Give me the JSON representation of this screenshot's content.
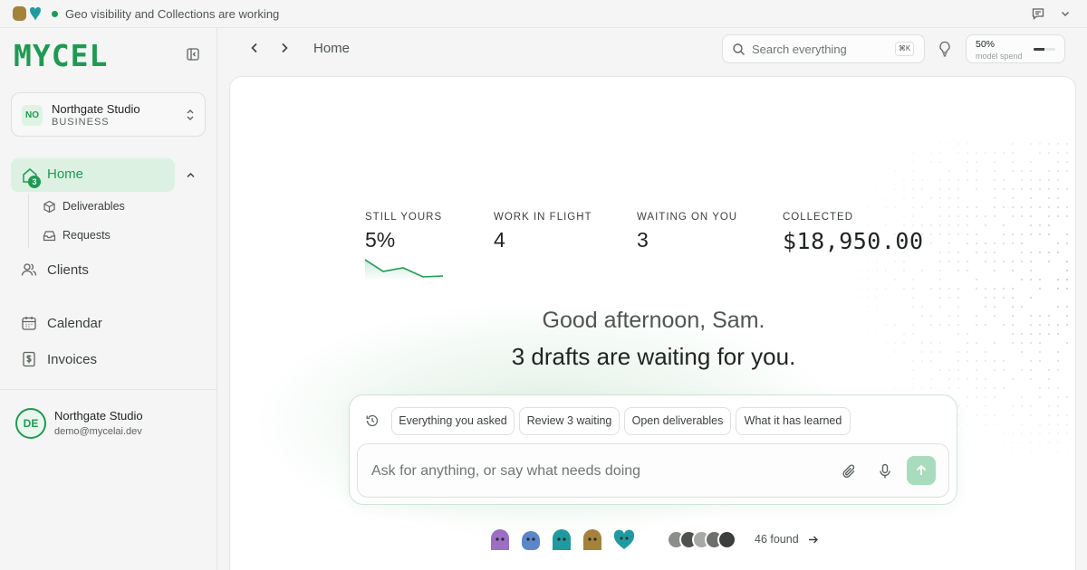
{
  "topbar": {
    "status_text": "Geo visibility and Collections are working",
    "status_color": "#1e9a52",
    "icons": [
      "mycel-mini-logo",
      "chat-icon",
      "chevron-down-icon"
    ]
  },
  "sidebar": {
    "brand": "MYCEL",
    "workspace": {
      "initials": "NO",
      "name": "Northgate Studio",
      "plan": "BUSINESS"
    },
    "home": {
      "label": "Home",
      "badge": "3"
    },
    "subitems": [
      {
        "label": "Deliverables",
        "icon": "box-icon"
      },
      {
        "label": "Requests",
        "icon": "inbox-icon"
      }
    ],
    "items": [
      {
        "label": "Clients",
        "icon": "users-icon"
      },
      {
        "label": "Calendar",
        "icon": "calendar-icon"
      },
      {
        "label": "Invoices",
        "icon": "invoice-icon"
      }
    ],
    "user": {
      "initials": "DE",
      "name": "Northgate Studio",
      "email": "demo@mycelai.dev"
    }
  },
  "header": {
    "breadcrumb": "Home",
    "search_placeholder": "Search everything",
    "search_shortcut": "⌘K",
    "spend": {
      "value": "50%",
      "label": "model spend",
      "fraction": 0.5
    }
  },
  "main": {
    "stats": [
      {
        "label": "STILL YOURS",
        "value": "5%"
      },
      {
        "label": "WORK IN FLIGHT",
        "value": "4"
      },
      {
        "label": "WAITING ON YOU",
        "value": "3"
      },
      {
        "label": "COLLECTED",
        "value": "$18,950.00"
      }
    ],
    "greeting": "Good afternoon, Sam.",
    "headline": "3 drafts are waiting for you.",
    "chips": [
      "Everything you asked",
      "Review 3 waiting",
      "Open deliverables",
      "What it has learned"
    ],
    "input_placeholder": "Ask for anything, or say what needs doing",
    "found_text": "46 found",
    "agent_colors": [
      "#9b6fc4",
      "#5b86c9",
      "#1f9aa0",
      "#a5823a",
      "#1f9aa0"
    ],
    "accent": "#1e9a52"
  }
}
